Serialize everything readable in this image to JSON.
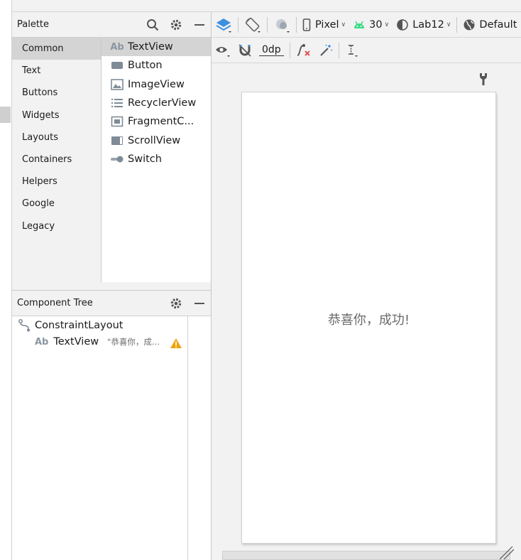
{
  "palette": {
    "title": "Palette",
    "categories": [
      {
        "label": "Common",
        "selected": true
      },
      {
        "label": "Text",
        "selected": false
      },
      {
        "label": "Buttons",
        "selected": false
      },
      {
        "label": "Widgets",
        "selected": false
      },
      {
        "label": "Layouts",
        "selected": false
      },
      {
        "label": "Containers",
        "selected": false
      },
      {
        "label": "Helpers",
        "selected": false
      },
      {
        "label": "Google",
        "selected": false
      },
      {
        "label": "Legacy",
        "selected": false
      }
    ],
    "widgets": [
      {
        "label": "TextView",
        "icon": "ab-text-icon",
        "selected": true
      },
      {
        "label": "Button",
        "icon": "button-icon",
        "selected": false
      },
      {
        "label": "ImageView",
        "icon": "image-icon",
        "selected": false
      },
      {
        "label": "RecyclerView",
        "icon": "list-icon",
        "selected": false
      },
      {
        "label": "FragmentC...",
        "icon": "fragment-icon",
        "selected": false
      },
      {
        "label": "ScrollView",
        "icon": "scroll-icon",
        "selected": false
      },
      {
        "label": "Switch",
        "icon": "switch-icon",
        "selected": false
      }
    ],
    "text_icon_glyph": "Ab"
  },
  "component_tree": {
    "title": "Component Tree",
    "root": {
      "label": "ConstraintLayout",
      "icon": "constraint-layout-icon"
    },
    "child": {
      "label": "TextView",
      "icon_glyph": "Ab",
      "value": "\"恭喜你，成...",
      "warning": true
    }
  },
  "toolbar": {
    "device": "Pixel",
    "api_level": "30",
    "theme": "Lab12",
    "locale": "Default",
    "margin": "0dp"
  },
  "design": {
    "text": "恭喜你，成功!"
  },
  "colors": {
    "accent_blue": "#3d8fe0",
    "android_green": "#3ddc84",
    "warning": "#f0a30a",
    "error_red": "#e05555"
  }
}
